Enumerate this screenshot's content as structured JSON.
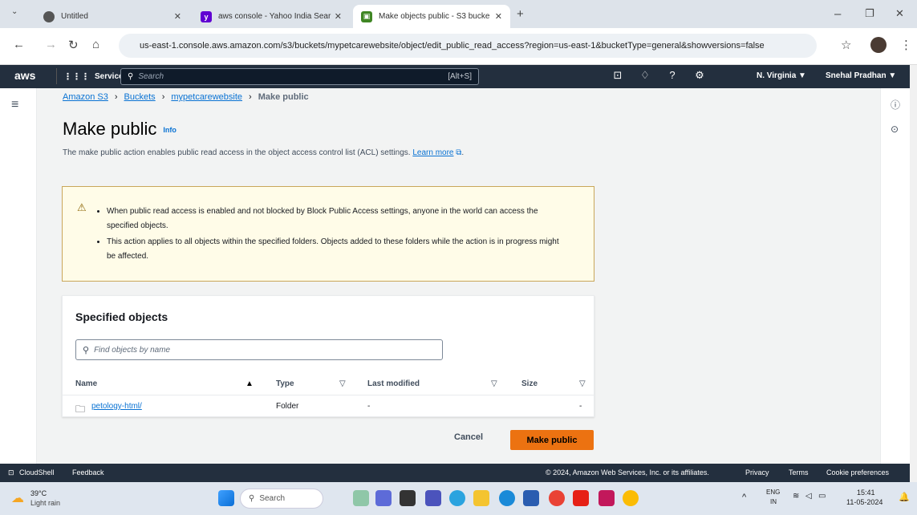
{
  "browser": {
    "tabs": [
      {
        "title": "Untitled",
        "active": false
      },
      {
        "title": "aws console - Yahoo India Sear",
        "active": false
      },
      {
        "title": "Make objects public - S3 bucke",
        "active": true
      }
    ],
    "url": "us-east-1.console.aws.amazon.com/s3/buckets/mypetcarewebsite/object/edit_public_read_access?region=us-east-1&bucketType=general&showversions=false"
  },
  "aws_nav": {
    "logo": "aws",
    "services_label": "Services",
    "search_placeholder": "Search",
    "search_shortcut": "[Alt+S]",
    "region": "N. Virginia ▼",
    "user": "Snehal Pradhan ▼"
  },
  "breadcrumb": {
    "items": [
      "Amazon S3",
      "Buckets",
      "mypetcarewebsite"
    ],
    "current": "Make public"
  },
  "page": {
    "title": "Make public",
    "info_link": "Info",
    "description": "The make public action enables public read access in the object access control list (ACL) settings.",
    "learn_more": "Learn more"
  },
  "alert": {
    "items": [
      "When public read access is enabled and not blocked by Block Public Access settings, anyone in the world can access the specified objects.",
      "This action applies to all objects within the specified folders. Objects added to these folders while the action is in progress might be affected."
    ]
  },
  "objects_panel": {
    "title": "Specified objects",
    "find_placeholder": "Find objects by name",
    "columns": [
      "Name",
      "Type",
      "Last modified",
      "Size"
    ],
    "rows": [
      {
        "name": "petology-html/",
        "type": "Folder",
        "last_modified": "-",
        "size": "-"
      }
    ]
  },
  "actions": {
    "cancel": "Cancel",
    "make_public": "Make public"
  },
  "footer": {
    "cloudshell": "CloudShell",
    "feedback": "Feedback",
    "copyright": "© 2024, Amazon Web Services, Inc. or its affiliates.",
    "privacy": "Privacy",
    "terms": "Terms",
    "cookies": "Cookie preferences"
  },
  "taskbar": {
    "weather_temp": "39°C",
    "weather_desc": "Light rain",
    "search": "Search",
    "lang": "ENG",
    "region": "IN",
    "time": "15:41",
    "date": "11-05-2024"
  },
  "colors": {
    "aws_nav": "#232f3e",
    "link": "#0972d3",
    "primary_button": "#ec7211",
    "warning_bg": "#fffce8"
  }
}
